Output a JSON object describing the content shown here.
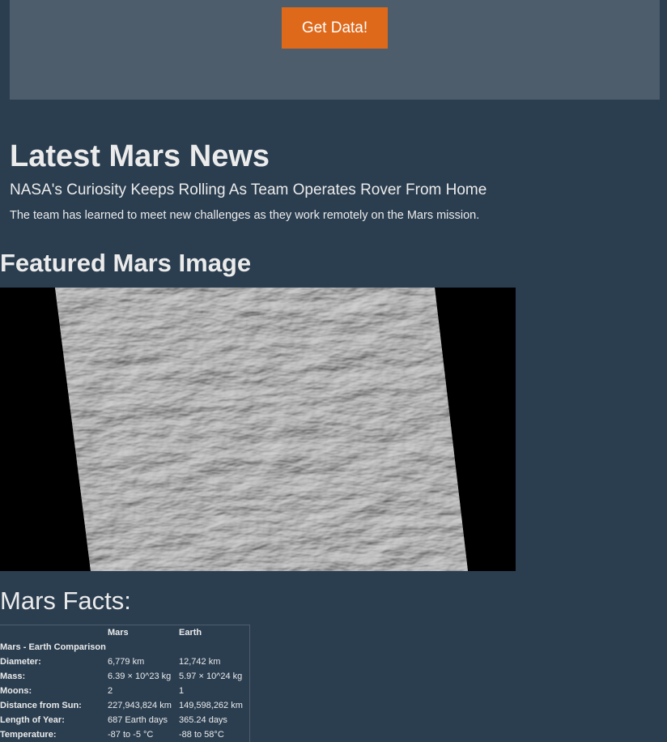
{
  "header": {
    "button_label": "Get Data!"
  },
  "news": {
    "section_title": "Latest Mars News",
    "headline": "NASA's Curiosity Keeps Rolling As Team Operates Rover From Home",
    "teaser": "The team has learned to meet new challenges as they work remotely on the Mars mission."
  },
  "featured": {
    "section_title": "Featured Mars Image"
  },
  "facts": {
    "section_title": "Mars Facts:",
    "columns": [
      "",
      "Mars",
      "Earth"
    ],
    "caption_row": "Mars - Earth Comparison",
    "rows": [
      [
        "Diameter:",
        "6,779 km",
        "12,742 km"
      ],
      [
        "Mass:",
        "6.39 × 10^23 kg",
        "5.97 × 10^24 kg"
      ],
      [
        "Moons:",
        "2",
        "1"
      ],
      [
        "Distance from Sun:",
        "227,943,824 km",
        "149,598,262 km"
      ],
      [
        "Length of Year:",
        "687 Earth days",
        "365.24 days"
      ],
      [
        "Temperature:",
        "-87 to -5 °C",
        "-88 to 58°C"
      ]
    ]
  },
  "colors": {
    "background": "#2b3e50",
    "jumbotron": "#4e5d6c",
    "accent": "#df691a",
    "text": "#ebebeb"
  }
}
